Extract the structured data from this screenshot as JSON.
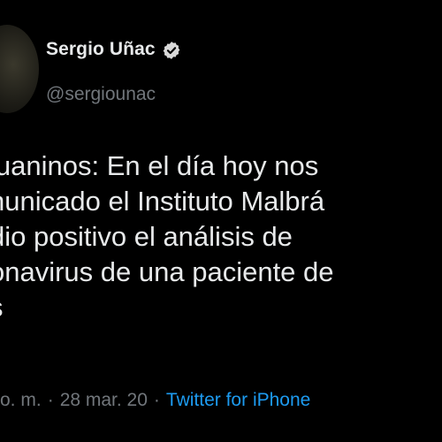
{
  "author": {
    "name": "Sergio Uñac",
    "handle": "@sergiounac",
    "verified_icon": "verified-badge-icon"
  },
  "tweet": {
    "lines": [
      "juaninos: En el día hoy nos",
      "nunicado el Instituto Malbrá",
      "dio positivo el análisis de",
      "onavirus de una paciente de",
      "s"
    ]
  },
  "meta": {
    "time": "o. m.",
    "separator_1": "·",
    "date": "28 mar. 20",
    "separator_2": "·",
    "source": "Twitter for iPhone"
  },
  "colors": {
    "background": "#000000",
    "text": "#e7e9ea",
    "secondary": "#71767b",
    "link": "#1d9bf0"
  }
}
